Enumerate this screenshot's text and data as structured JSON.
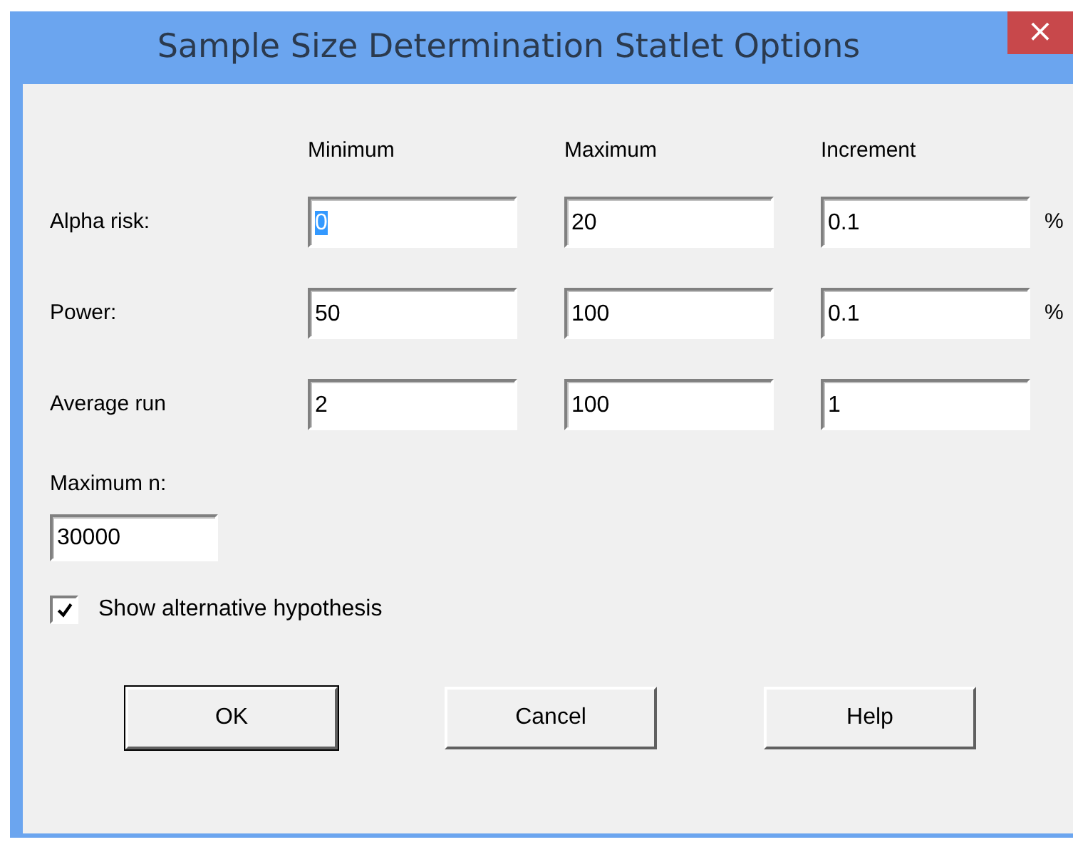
{
  "window": {
    "title": "Sample Size Determination Statlet Options",
    "close": "×"
  },
  "columns": [
    "Minimum",
    "Maximum",
    "Increment"
  ],
  "rows": [
    {
      "label": "Alpha risk:",
      "values": [
        {
          "text": "0",
          "selected": true
        },
        {
          "text": "20",
          "selected": false
        },
        {
          "text": "0.1",
          "selected": false
        }
      ],
      "unit": "%"
    },
    {
      "label": "Power:",
      "values": [
        {
          "text": "50",
          "selected": false
        },
        {
          "text": "100",
          "selected": false
        },
        {
          "text": "0.1",
          "selected": false
        }
      ],
      "unit": "%"
    },
    {
      "label": "Average run",
      "values": [
        {
          "text": "2",
          "selected": false
        },
        {
          "text": "100",
          "selected": false
        },
        {
          "text": "1",
          "selected": false
        }
      ]
    }
  ],
  "maximum_n": {
    "label": "Maximum n:",
    "value": "30000"
  },
  "show_alternative": {
    "label": "Show alternative hypothesis",
    "checked": true
  },
  "buttons": [
    "OK",
    "Cancel",
    "Help"
  ]
}
